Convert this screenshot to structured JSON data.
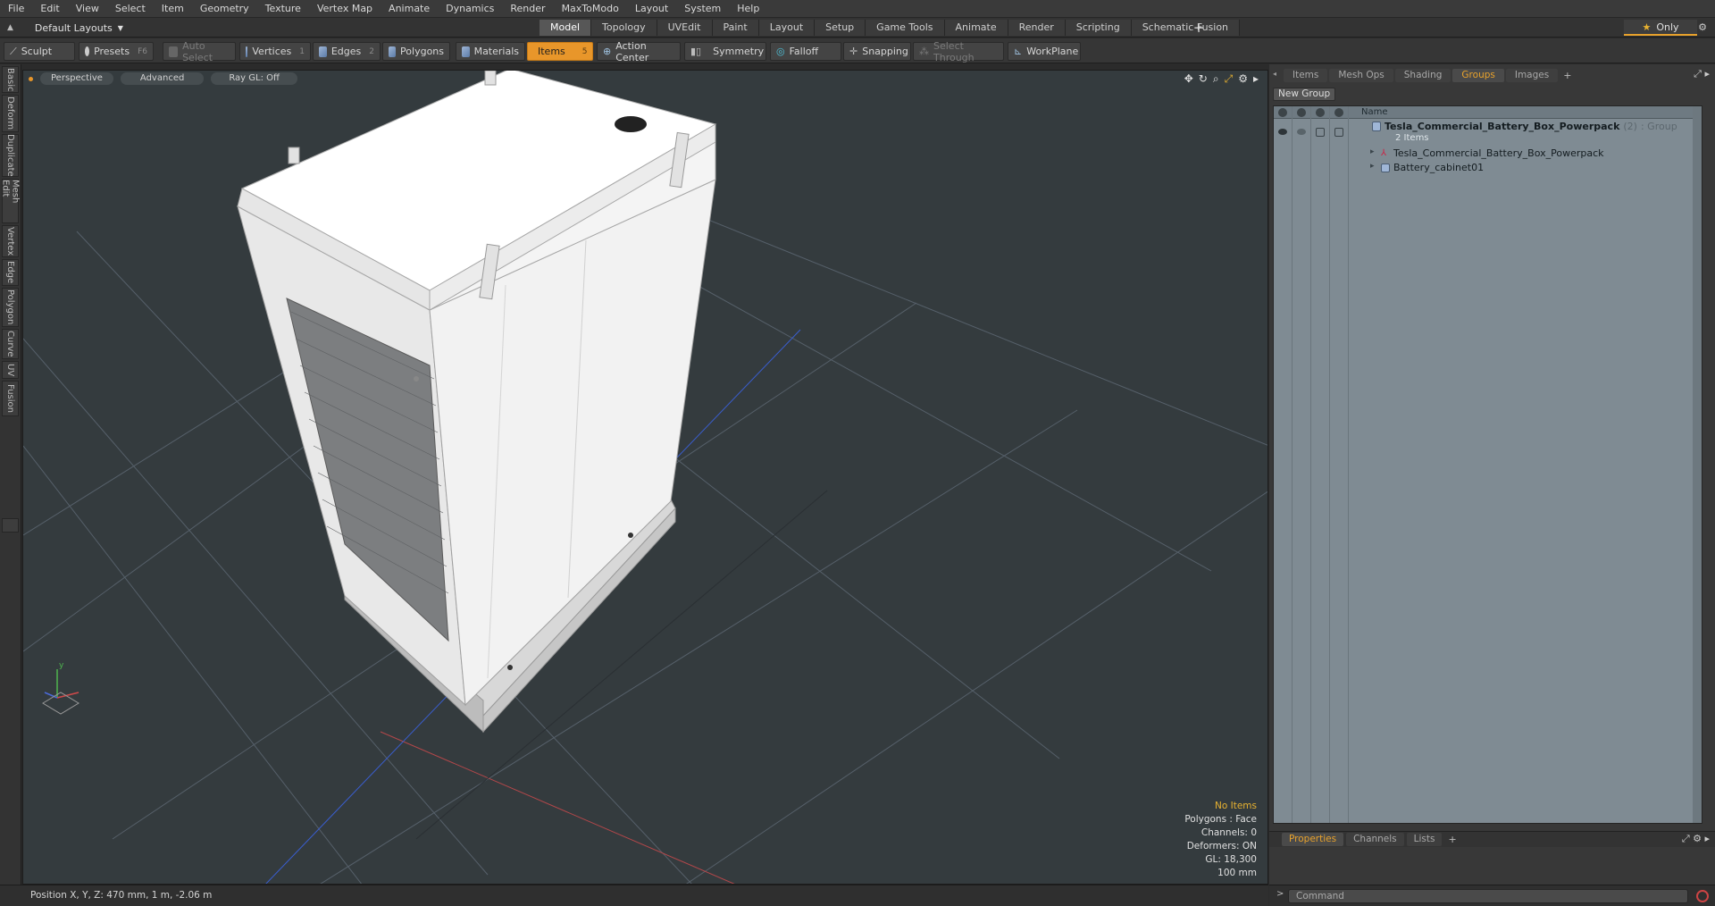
{
  "menu": [
    "File",
    "Edit",
    "View",
    "Select",
    "Item",
    "Geometry",
    "Texture",
    "Vertex Map",
    "Animate",
    "Dynamics",
    "Render",
    "MaxToModo",
    "Layout",
    "System",
    "Help"
  ],
  "layout_select": "Default Layouts",
  "layout_tabs": [
    {
      "label": "Model",
      "active": true
    },
    {
      "label": "Topology"
    },
    {
      "label": "UVEdit"
    },
    {
      "label": "Paint"
    },
    {
      "label": "Layout"
    },
    {
      "label": "Setup"
    },
    {
      "label": "Game Tools"
    },
    {
      "label": "Animate"
    },
    {
      "label": "Render"
    },
    {
      "label": "Scripting"
    },
    {
      "label": "Schematic Fusion"
    }
  ],
  "only_label": "Only",
  "toolbar": {
    "sculpt": "Sculpt",
    "presets": "Presets",
    "presets_key": "F6",
    "auto_select": "Auto Select",
    "vertices": "Vertices",
    "vertices_key": "1",
    "edges": "Edges",
    "edges_key": "2",
    "polygons": "Polygons",
    "materials": "Materials",
    "items": "Items",
    "items_key": "5",
    "action_center": "Action Center",
    "symmetry": "Symmetry",
    "falloff": "Falloff",
    "snapping": "Snapping",
    "select_through": "Select Through",
    "workplane": "WorkPlane"
  },
  "left_tabs": [
    "Basic",
    "Deform",
    "Duplicate",
    "Mesh Edit",
    "Vertex",
    "Edge",
    "Polygon",
    "Curve",
    "UV",
    "Fusion"
  ],
  "viewport": {
    "view": "Perspective",
    "shading": "Advanced",
    "raygl": "Ray GL: Off",
    "info": {
      "items": "No Items",
      "polygons": "Polygons : Face",
      "channels": "Channels: 0",
      "deformers": "Deformers: ON",
      "gl": "GL: 18,300",
      "scale": "100 mm"
    }
  },
  "right_tabs": [
    {
      "label": "Items"
    },
    {
      "label": "Mesh Ops"
    },
    {
      "label": "Shading"
    },
    {
      "label": "Groups",
      "active": true
    },
    {
      "label": "Images"
    }
  ],
  "new_group": "New Group",
  "list": {
    "name_header": "Name",
    "group_name": "Tesla_Commercial_Battery_Box_Powerpack",
    "group_count": "(2)",
    "group_type": ": Group",
    "group_items": "2 Items",
    "children": [
      "Tesla_Commercial_Battery_Box_Powerpack",
      "Battery_cabinet01"
    ]
  },
  "bottom_tabs": [
    {
      "label": "Properties",
      "active": true
    },
    {
      "label": "Channels"
    },
    {
      "label": "Lists"
    }
  ],
  "status": "Position X, Y, Z:   470 mm, 1 m, -2.06 m",
  "command_placeholder": "Command",
  "colors": {
    "accent": "#e8962a",
    "viewport_bg": "#343b3e",
    "list_bg": "#7f8b93"
  }
}
